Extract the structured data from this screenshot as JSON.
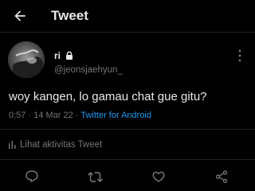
{
  "header": {
    "back_icon": "arrow-left-icon",
    "title": "Tweet"
  },
  "tweet": {
    "author": {
      "display_name": "ri",
      "protected_icon": "lock-icon",
      "handle": "@jeonsjaehyun_"
    },
    "text": "woy kangen, lo gamau chat gue gitu?",
    "time": "0:57",
    "separator": "·",
    "date": "14 Mar 22",
    "source": "Twitter for Android",
    "analytics_label": "Lihat aktivitas Tweet"
  },
  "actions": [
    {
      "icon": "reply-icon"
    },
    {
      "icon": "retweet-icon"
    },
    {
      "icon": "like-icon"
    },
    {
      "icon": "share-icon"
    }
  ],
  "colors": {
    "background": "#000000",
    "text_primary": "#e7e9ea",
    "text_secondary": "#71767b",
    "accent": "#1d9bf0",
    "divider": "#1f2327"
  }
}
